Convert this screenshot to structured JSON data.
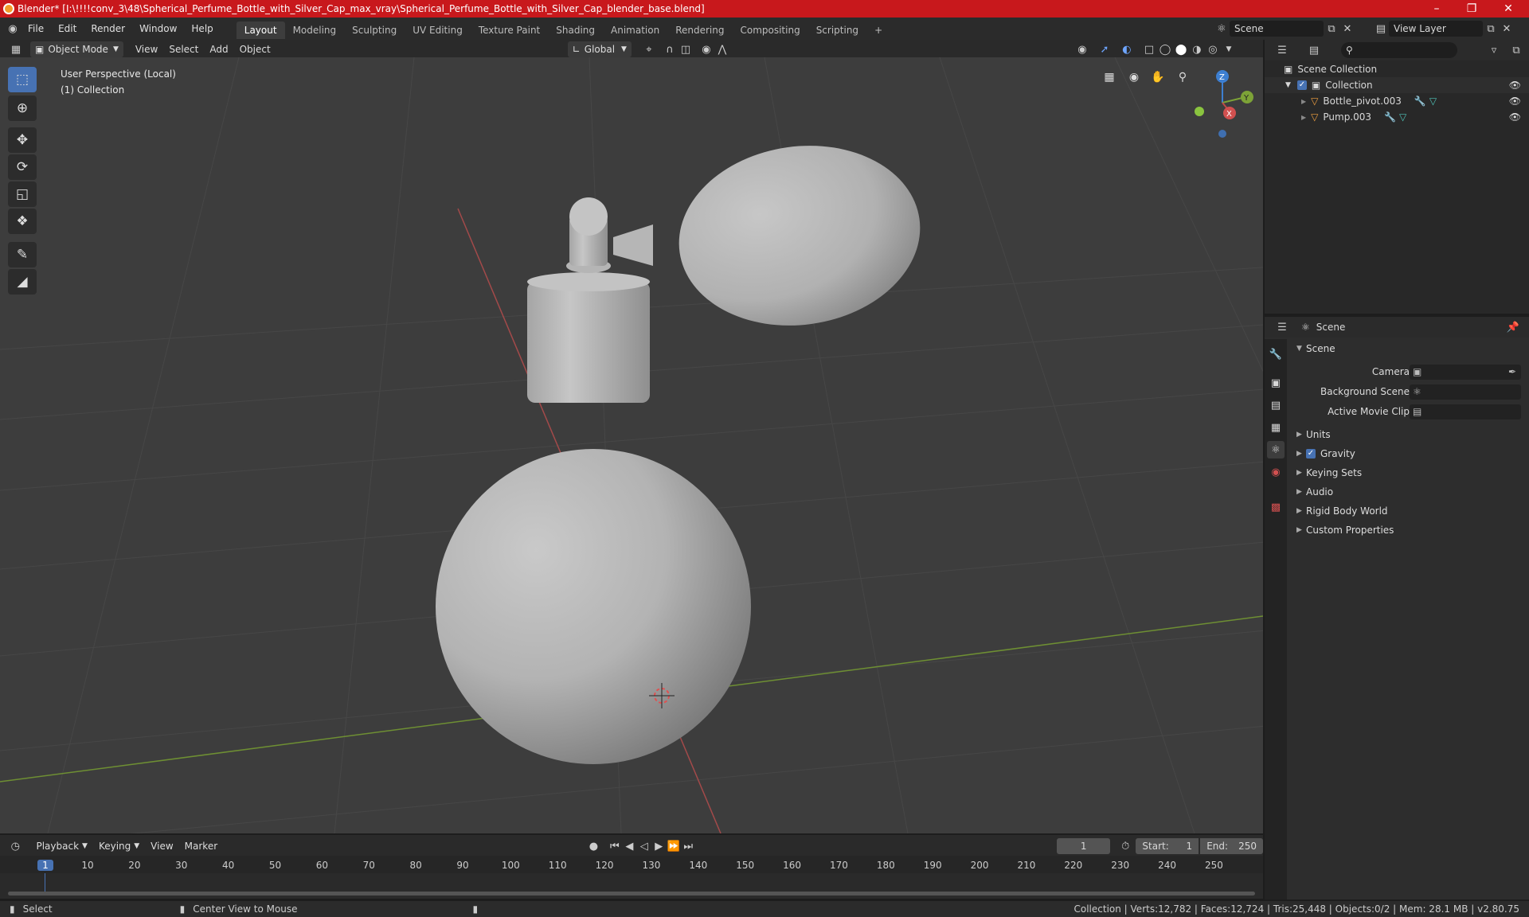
{
  "window": {
    "title": "Blender* [I:\\!!!!conv_3\\48\\Spherical_Perfume_Bottle_with_Silver_Cap_max_vray\\Spherical_Perfume_Bottle_with_Silver_Cap_blender_base.blend]",
    "minimize": "–",
    "maximize": "❐",
    "close": "✕"
  },
  "menu": [
    "File",
    "Edit",
    "Render",
    "Window",
    "Help"
  ],
  "workspaces": [
    "Layout",
    "Modeling",
    "Sculpting",
    "UV Editing",
    "Texture Paint",
    "Shading",
    "Animation",
    "Rendering",
    "Compositing",
    "Scripting"
  ],
  "active_workspace": "Layout",
  "add_workspace": "+",
  "scene_selector": {
    "value": "Scene"
  },
  "view_layer_selector": {
    "value": "View Layer"
  },
  "viewport": {
    "mode": "Object Mode",
    "menus": [
      "View",
      "Select",
      "Add",
      "Object"
    ],
    "transform_orientation": "Global",
    "info_line1": "User Perspective (Local)",
    "info_line2": "(1) Collection",
    "axis_labels": {
      "x": "X",
      "y": "Y",
      "z": "Z"
    }
  },
  "outliner": {
    "search_placeholder": "",
    "root": "Scene Collection",
    "collection": "Collection",
    "objects": [
      "Bottle_pivot.003",
      "Pump.003"
    ]
  },
  "properties": {
    "header": "Scene",
    "section": "Scene",
    "fields": {
      "camera": "Camera",
      "background_scene": "Background Scene",
      "active_movie_clip": "Active Movie Clip"
    },
    "panels": [
      "Units",
      "Gravity",
      "Keying Sets",
      "Audio",
      "Rigid Body World",
      "Custom Properties"
    ]
  },
  "timeline": {
    "menus": [
      "Playback",
      "Keying",
      "View",
      "Marker"
    ],
    "current_frame": "1",
    "start_label": "Start:",
    "start": "1",
    "end_label": "End:",
    "end": "250",
    "ticks": [
      "1",
      "10",
      "20",
      "30",
      "40",
      "50",
      "60",
      "70",
      "80",
      "90",
      "100",
      "110",
      "120",
      "130",
      "140",
      "150",
      "160",
      "170",
      "180",
      "190",
      "200",
      "210",
      "220",
      "230",
      "240",
      "250"
    ]
  },
  "statusbar": {
    "select": "Select",
    "center_view": "Center View to Mouse",
    "stats": "Collection | Verts:12,782 | Faces:12,724 | Tris:25,448 | Objects:0/2 | Mem: 28.1 MB | v2.80.75"
  },
  "colors": {
    "titlebar": "#c8181c",
    "viewport_bg": "#3d3d3d",
    "active_blue": "#4772b3",
    "x_axis": "#c04a4a",
    "y_axis": "#7da337",
    "z_axis": "#3d7fd1"
  }
}
